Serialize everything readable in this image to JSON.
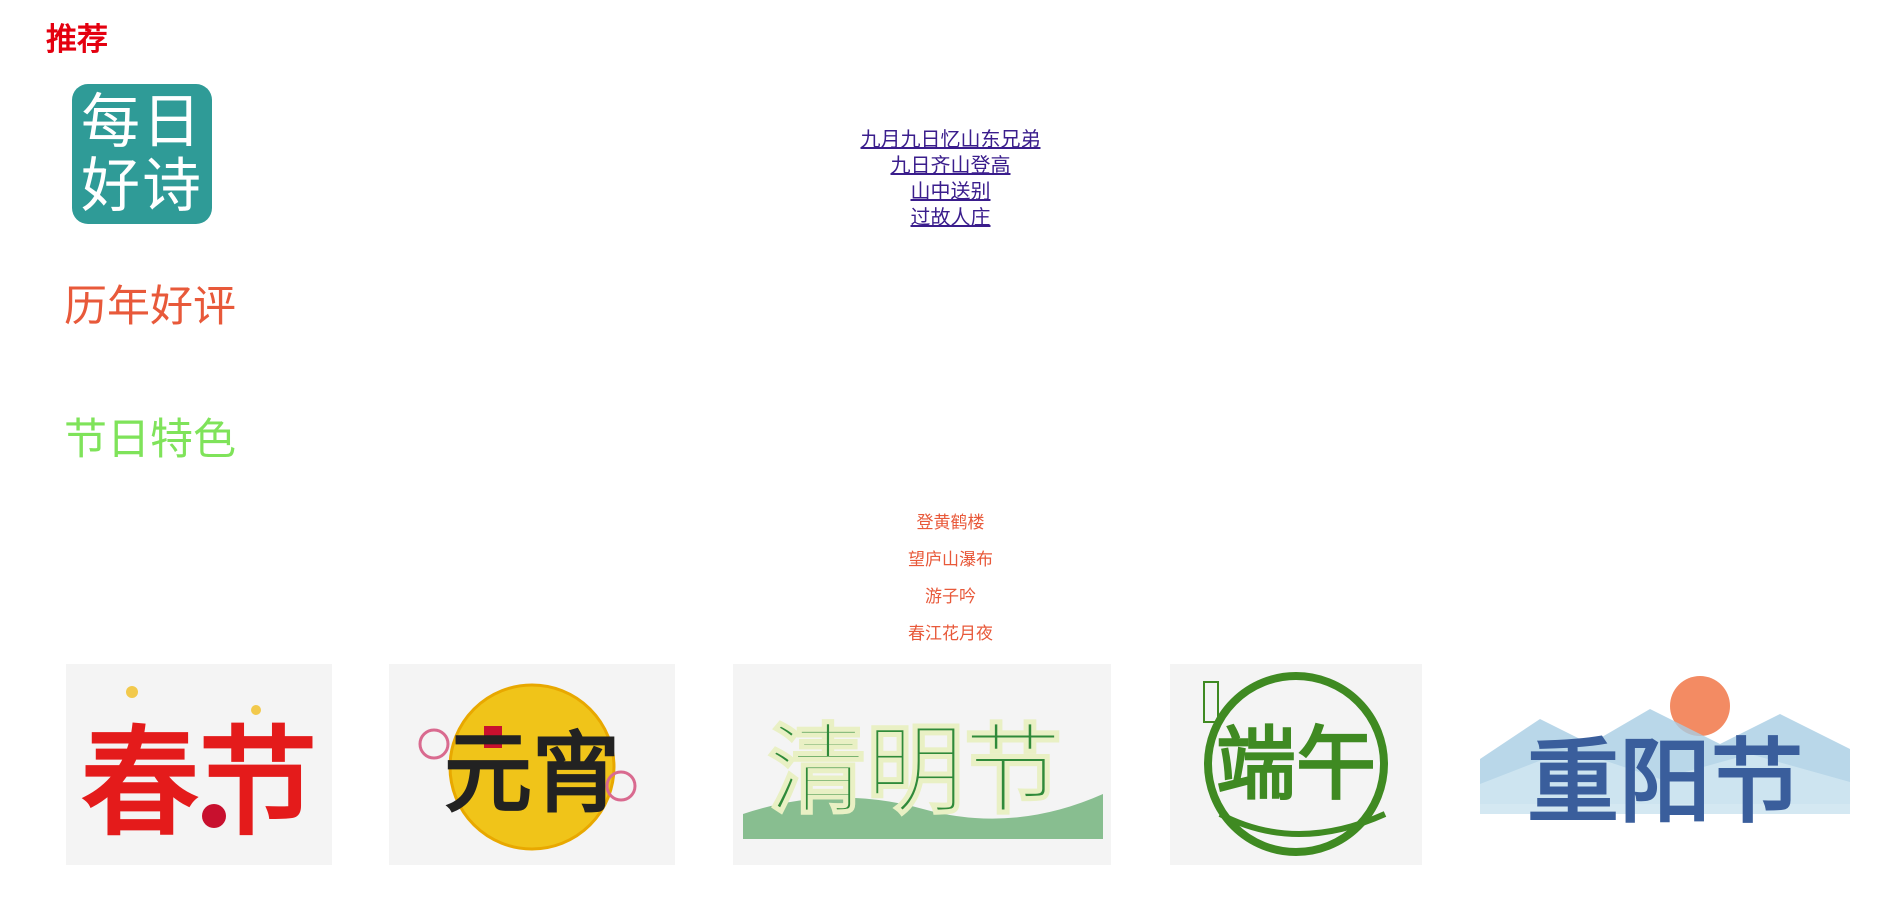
{
  "header": {
    "title": "推荐"
  },
  "logo": {
    "line1": "每日",
    "line2": "好诗",
    "color": "#2f9b97"
  },
  "links": [
    {
      "label": "九月九日忆山东兄弟"
    },
    {
      "label": "九日齐山登高"
    },
    {
      "label": "山中送别"
    },
    {
      "label": "过故人庄"
    }
  ],
  "sections": {
    "reviews": "历年好评",
    "festival": "节日特色"
  },
  "picks": [
    {
      "label": "登黄鹤楼"
    },
    {
      "label": "望庐山瀑布"
    },
    {
      "label": "游子吟"
    },
    {
      "label": "春江花月夜"
    }
  ],
  "festivals": [
    {
      "label": "春节",
      "color": "#e41b1b"
    },
    {
      "label": "元宵",
      "color": "#222222"
    },
    {
      "label": "清明节",
      "color": "#2f8a3a"
    },
    {
      "label": "端午",
      "color": "#3f8a22"
    },
    {
      "label": "重阳节",
      "color": "#3a5e9c"
    }
  ],
  "colors": {
    "title": "#e4000f",
    "reviews": "#e8593a",
    "festival": "#7fe35a",
    "link": "#3a1d8c"
  }
}
